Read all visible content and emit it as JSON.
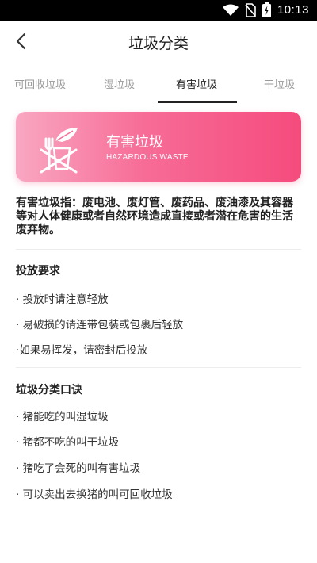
{
  "status_bar": {
    "time": "10:13",
    "icons": [
      "wifi-icon",
      "no-sim-icon",
      "battery-charging-icon"
    ]
  },
  "header": {
    "title": "垃圾分类",
    "back_icon": "chevron-left-icon"
  },
  "tabs": [
    {
      "label": "可回收垃圾",
      "active": false
    },
    {
      "label": "湿垃圾",
      "active": false
    },
    {
      "label": "有害垃圾",
      "active": true
    },
    {
      "label": "干垃圾",
      "active": false
    }
  ],
  "banner": {
    "title": "有害垃圾",
    "subtitle": "HAZARDOUS WASTE",
    "icon": "hazardous-waste-icon",
    "colors": {
      "start": "#f9a7c2",
      "end": "#f54b7d"
    }
  },
  "definition": "有害垃圾指：废电池、废灯管、废药品、废油漆及其容器等对人体健康或者自然环境造成直接或者潜在危害的生活废弃物。",
  "sections": [
    {
      "title": "投放要求",
      "items": [
        "· 投放时请注意轻放",
        "· 易破损的请连带包装或包裹后轻放",
        "·如果易挥发，请密封后投放"
      ]
    },
    {
      "title": "垃圾分类口诀",
      "items": [
        "· 猪能吃的叫湿垃圾",
        "· 猪都不吃的叫干垃圾",
        "· 猪吃了会死的叫有害垃圾",
        "· 可以卖出去换猪的叫可回收垃圾"
      ]
    }
  ]
}
